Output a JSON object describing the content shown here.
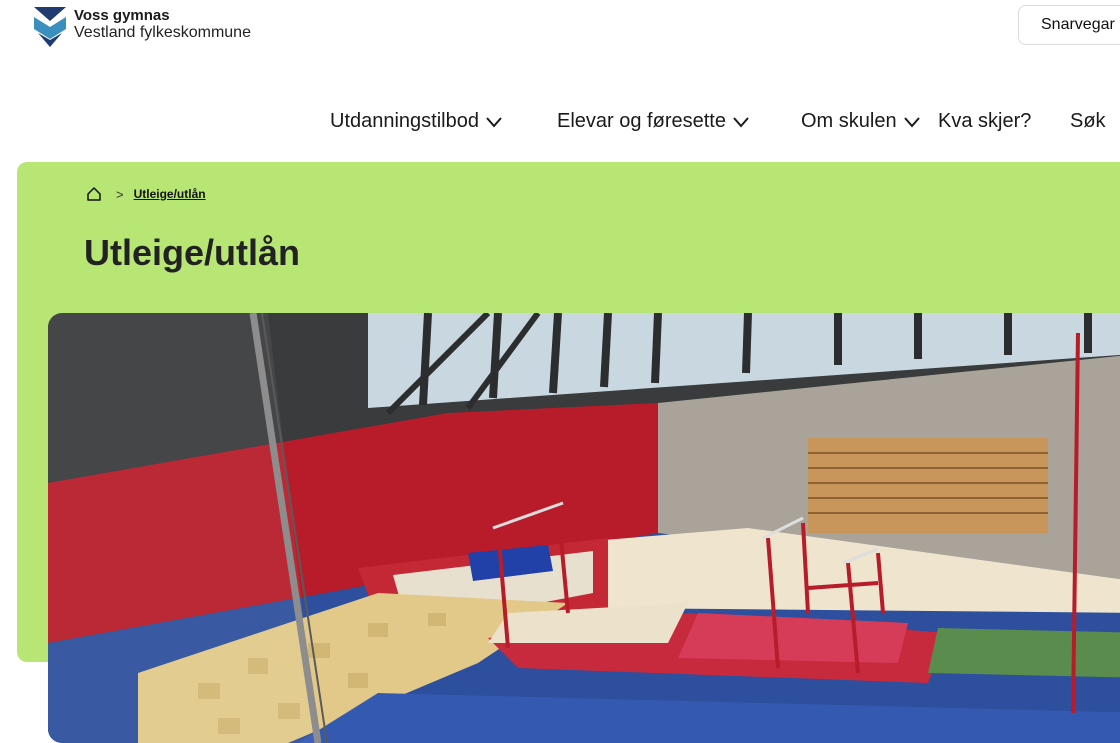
{
  "header": {
    "school_name": "Voss gymnas",
    "county_name": "Vestland fylkeskommune",
    "shortcut_label": "Snarvegar"
  },
  "nav": {
    "items": [
      {
        "label": "Utdanningstilbod",
        "has_dropdown": true
      },
      {
        "label": "Elevar og føresette",
        "has_dropdown": true
      },
      {
        "label": "Om skulen",
        "has_dropdown": true
      },
      {
        "label": "Kva skjer?",
        "has_dropdown": false
      },
      {
        "label": "Søk",
        "has_dropdown": false
      }
    ]
  },
  "breadcrumb": {
    "current": "Utleige/utlån"
  },
  "page": {
    "title": "Utleige/utlån"
  },
  "hero_image": {
    "icon": "gymnastics-hall-photo"
  },
  "colors": {
    "hero_background": "#b8e675",
    "logo_dark": "#1f3b6f",
    "logo_light": "#3fa0c8"
  }
}
